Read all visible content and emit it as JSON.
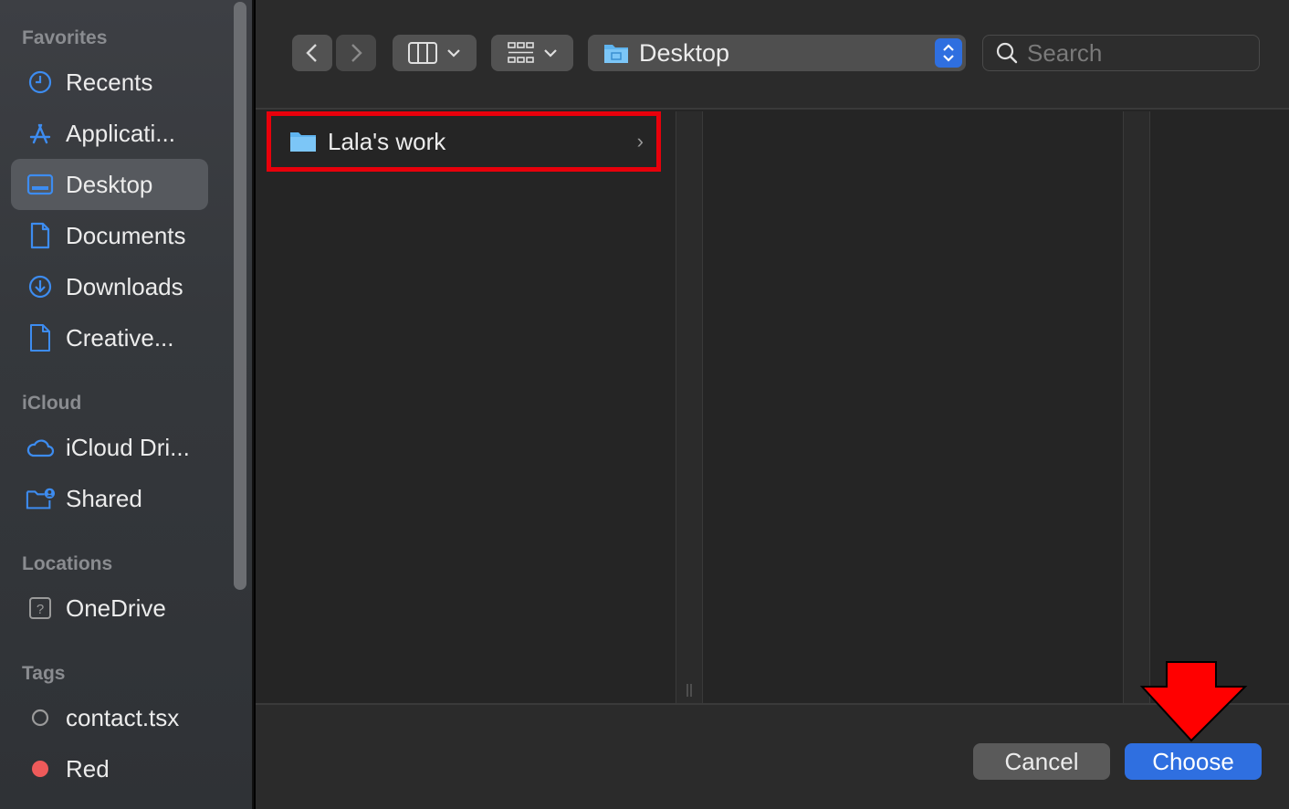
{
  "sidebar": {
    "favorites_title": "Favorites",
    "favorites": [
      {
        "label": "Recents",
        "icon": "clock-icon"
      },
      {
        "label": "Applicati...",
        "icon": "applications-icon"
      },
      {
        "label": "Desktop",
        "icon": "desktop-icon",
        "selected": true
      },
      {
        "label": "Documents",
        "icon": "document-icon"
      },
      {
        "label": "Downloads",
        "icon": "download-icon"
      },
      {
        "label": "Creative...",
        "icon": "file-icon"
      }
    ],
    "icloud_title": "iCloud",
    "icloud": [
      {
        "label": "iCloud Dri...",
        "icon": "cloud-icon"
      },
      {
        "label": "Shared",
        "icon": "shared-folder-icon"
      }
    ],
    "locations_title": "Locations",
    "locations": [
      {
        "label": "OneDrive",
        "icon": "unknown-drive-icon"
      }
    ],
    "tags_title": "Tags",
    "tags": [
      {
        "label": "contact.tsx",
        "color": "#9a9a9a"
      },
      {
        "label": "Red",
        "color": "#ee5a5a"
      }
    ]
  },
  "toolbar": {
    "path": "Desktop",
    "search_placeholder": "Search"
  },
  "browser": {
    "items": [
      {
        "label": "Lala's work",
        "icon": "folder-icon",
        "highlighted": true
      }
    ]
  },
  "buttons": {
    "cancel": "Cancel",
    "choose": "Choose"
  },
  "colors": {
    "accent": "#2f6fe0",
    "highlight_box": "#e8000b",
    "annotation_arrow": "#ff0000"
  }
}
